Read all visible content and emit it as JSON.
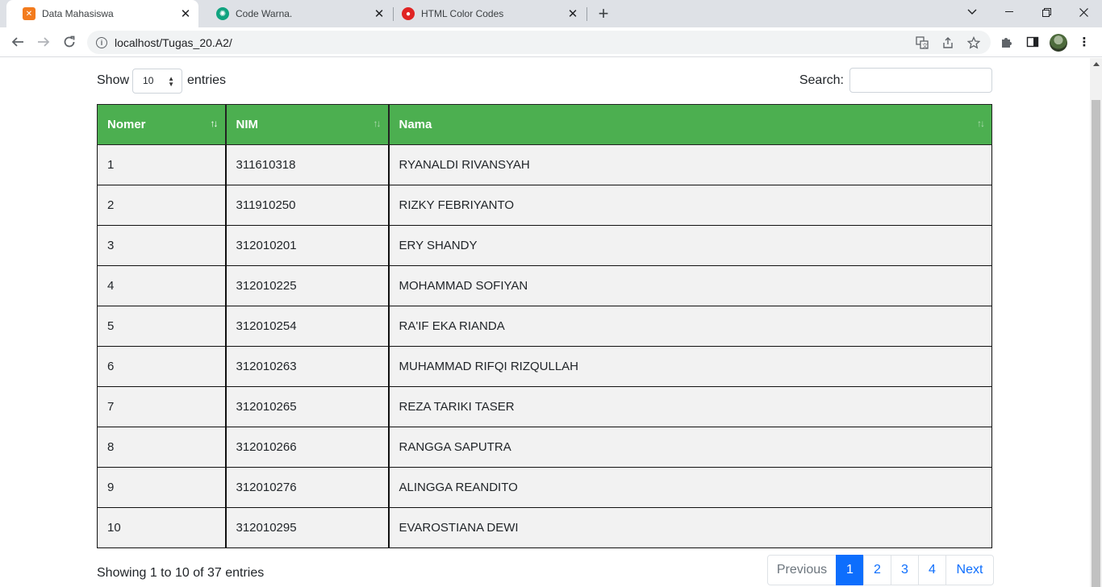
{
  "browser": {
    "tabs": [
      {
        "title": "Data Mahasiswa",
        "active": true,
        "favicon": "xampp-icon",
        "favicon_color": "#f37b1d"
      },
      {
        "title": "Code Warna.",
        "active": false,
        "favicon": "chatgpt-icon",
        "favicon_color": "#10a37f"
      },
      {
        "title": "HTML Color Codes",
        "active": false,
        "favicon": "colorcodes-icon",
        "favicon_color": "#e02424"
      }
    ],
    "url": "localhost/Tugas_20.A2/"
  },
  "page": {
    "length_prefix": "Show",
    "length_value": "10",
    "length_suffix": "entries",
    "search_label": "Search:",
    "search_value": "",
    "table": {
      "header_color": "#4caf50",
      "columns": [
        "Nomer",
        "NIM",
        "Nama"
      ],
      "rows": [
        [
          "1",
          "311610318",
          "RYANALDI RIVANSYAH"
        ],
        [
          "2",
          "311910250",
          "RIZKY FEBRIYANTO"
        ],
        [
          "3",
          "312010201",
          "ERY SHANDY"
        ],
        [
          "4",
          "312010225",
          "MOHAMMAD SOFIYAN"
        ],
        [
          "5",
          "312010254",
          "RA'IF EKA RIANDA"
        ],
        [
          "6",
          "312010263",
          "MUHAMMAD RIFQI RIZQULLAH"
        ],
        [
          "7",
          "312010265",
          "REZA TARIKI TASER"
        ],
        [
          "8",
          "312010266",
          "RANGGA SAPUTRA"
        ],
        [
          "9",
          "312010276",
          "ALINGGA REANDITO"
        ],
        [
          "10",
          "312010295",
          "EVAROSTIANA DEWI"
        ]
      ]
    },
    "info": "Showing 1 to 10 of 37 entries",
    "pagination": {
      "previous": "Previous",
      "pages": [
        "1",
        "2",
        "3",
        "4"
      ],
      "active_page": "1",
      "next": "Next",
      "active_color": "#0d6efd"
    }
  }
}
